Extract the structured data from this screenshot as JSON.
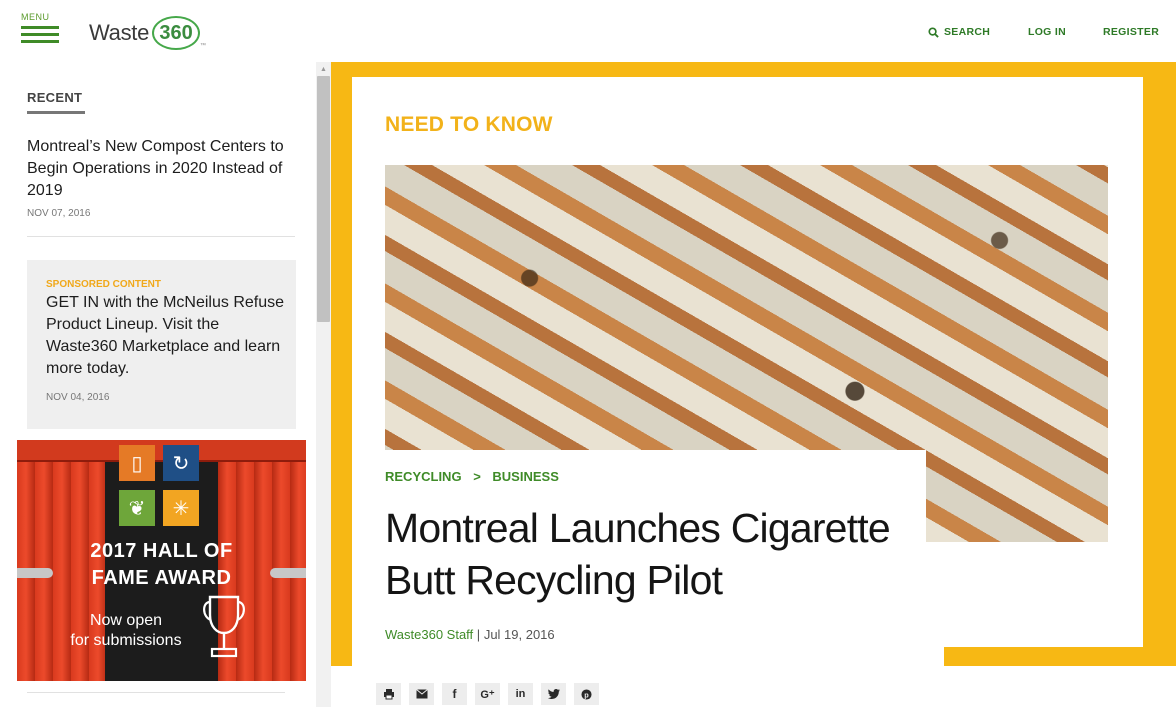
{
  "header": {
    "menu_label": "MENU",
    "logo_word": "Waste",
    "logo_number": "360",
    "nav": {
      "search": "SEARCH",
      "login": "LOG IN",
      "register": "REGISTER"
    }
  },
  "sidebar": {
    "recent_heading": "RECENT",
    "recent_item": {
      "title": "Montreal’s New Compost Centers to Begin Operations in 2020 Instead of 2019",
      "date": "NOV 07, 2016"
    },
    "sponsored": {
      "label": "SPONSORED CONTENT",
      "title": "GET IN with the McNeilus Refuse Product Lineup. Visit the Waste360 Marketplace and learn more today.",
      "date": "NOV 04, 2016"
    },
    "ad": {
      "award_line1": "2017 HALL OF",
      "award_line2": "FAME AWARD",
      "sub_line1": "Now open",
      "sub_line2": "for submissions"
    }
  },
  "article": {
    "section_label": "NEED TO KNOW",
    "breadcrumb": [
      "RECYCLING",
      "BUSINESS"
    ],
    "breadcrumb_sep": ">",
    "title": "Montreal Launches Cigarette Butt Recycling Pilot",
    "author": "Waste360 Staff",
    "byline_sep": "|",
    "date": "Jul 19, 2016"
  },
  "share_buttons": [
    "print-icon",
    "email-icon",
    "facebook-icon",
    "google-plus-icon",
    "linkedin-icon",
    "twitter-icon",
    "pinterest-icon"
  ],
  "colors": {
    "brand_green": "#3f8b28",
    "accent_yellow": "#f7b814",
    "ad_red": "#e2401f"
  }
}
